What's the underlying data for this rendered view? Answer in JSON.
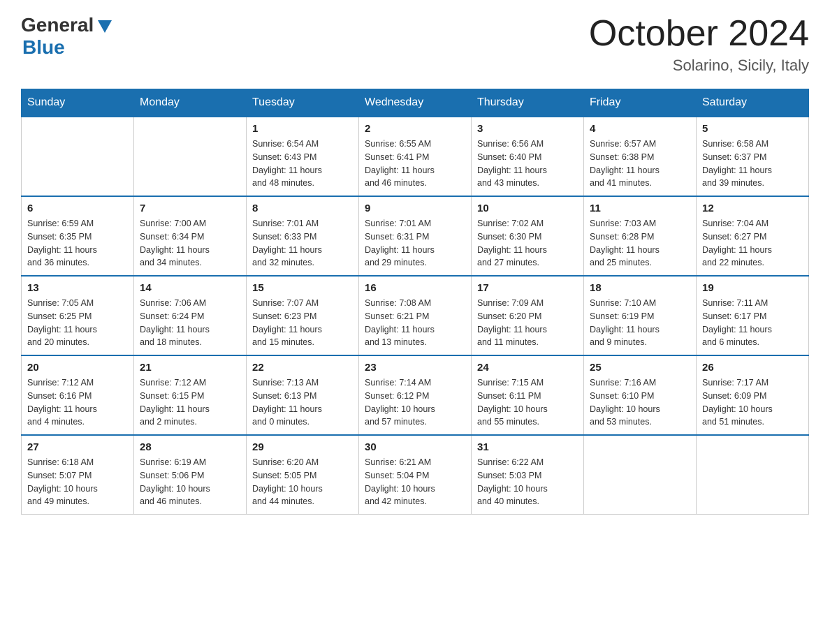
{
  "header": {
    "logo": {
      "general": "General",
      "blue": "Blue"
    },
    "title": "October 2024",
    "location": "Solarino, Sicily, Italy"
  },
  "weekdays": [
    "Sunday",
    "Monday",
    "Tuesday",
    "Wednesday",
    "Thursday",
    "Friday",
    "Saturday"
  ],
  "weeks": [
    [
      {
        "day": "",
        "info": ""
      },
      {
        "day": "",
        "info": ""
      },
      {
        "day": "1",
        "info": "Sunrise: 6:54 AM\nSunset: 6:43 PM\nDaylight: 11 hours\nand 48 minutes."
      },
      {
        "day": "2",
        "info": "Sunrise: 6:55 AM\nSunset: 6:41 PM\nDaylight: 11 hours\nand 46 minutes."
      },
      {
        "day": "3",
        "info": "Sunrise: 6:56 AM\nSunset: 6:40 PM\nDaylight: 11 hours\nand 43 minutes."
      },
      {
        "day": "4",
        "info": "Sunrise: 6:57 AM\nSunset: 6:38 PM\nDaylight: 11 hours\nand 41 minutes."
      },
      {
        "day": "5",
        "info": "Sunrise: 6:58 AM\nSunset: 6:37 PM\nDaylight: 11 hours\nand 39 minutes."
      }
    ],
    [
      {
        "day": "6",
        "info": "Sunrise: 6:59 AM\nSunset: 6:35 PM\nDaylight: 11 hours\nand 36 minutes."
      },
      {
        "day": "7",
        "info": "Sunrise: 7:00 AM\nSunset: 6:34 PM\nDaylight: 11 hours\nand 34 minutes."
      },
      {
        "day": "8",
        "info": "Sunrise: 7:01 AM\nSunset: 6:33 PM\nDaylight: 11 hours\nand 32 minutes."
      },
      {
        "day": "9",
        "info": "Sunrise: 7:01 AM\nSunset: 6:31 PM\nDaylight: 11 hours\nand 29 minutes."
      },
      {
        "day": "10",
        "info": "Sunrise: 7:02 AM\nSunset: 6:30 PM\nDaylight: 11 hours\nand 27 minutes."
      },
      {
        "day": "11",
        "info": "Sunrise: 7:03 AM\nSunset: 6:28 PM\nDaylight: 11 hours\nand 25 minutes."
      },
      {
        "day": "12",
        "info": "Sunrise: 7:04 AM\nSunset: 6:27 PM\nDaylight: 11 hours\nand 22 minutes."
      }
    ],
    [
      {
        "day": "13",
        "info": "Sunrise: 7:05 AM\nSunset: 6:25 PM\nDaylight: 11 hours\nand 20 minutes."
      },
      {
        "day": "14",
        "info": "Sunrise: 7:06 AM\nSunset: 6:24 PM\nDaylight: 11 hours\nand 18 minutes."
      },
      {
        "day": "15",
        "info": "Sunrise: 7:07 AM\nSunset: 6:23 PM\nDaylight: 11 hours\nand 15 minutes."
      },
      {
        "day": "16",
        "info": "Sunrise: 7:08 AM\nSunset: 6:21 PM\nDaylight: 11 hours\nand 13 minutes."
      },
      {
        "day": "17",
        "info": "Sunrise: 7:09 AM\nSunset: 6:20 PM\nDaylight: 11 hours\nand 11 minutes."
      },
      {
        "day": "18",
        "info": "Sunrise: 7:10 AM\nSunset: 6:19 PM\nDaylight: 11 hours\nand 9 minutes."
      },
      {
        "day": "19",
        "info": "Sunrise: 7:11 AM\nSunset: 6:17 PM\nDaylight: 11 hours\nand 6 minutes."
      }
    ],
    [
      {
        "day": "20",
        "info": "Sunrise: 7:12 AM\nSunset: 6:16 PM\nDaylight: 11 hours\nand 4 minutes."
      },
      {
        "day": "21",
        "info": "Sunrise: 7:12 AM\nSunset: 6:15 PM\nDaylight: 11 hours\nand 2 minutes."
      },
      {
        "day": "22",
        "info": "Sunrise: 7:13 AM\nSunset: 6:13 PM\nDaylight: 11 hours\nand 0 minutes."
      },
      {
        "day": "23",
        "info": "Sunrise: 7:14 AM\nSunset: 6:12 PM\nDaylight: 10 hours\nand 57 minutes."
      },
      {
        "day": "24",
        "info": "Sunrise: 7:15 AM\nSunset: 6:11 PM\nDaylight: 10 hours\nand 55 minutes."
      },
      {
        "day": "25",
        "info": "Sunrise: 7:16 AM\nSunset: 6:10 PM\nDaylight: 10 hours\nand 53 minutes."
      },
      {
        "day": "26",
        "info": "Sunrise: 7:17 AM\nSunset: 6:09 PM\nDaylight: 10 hours\nand 51 minutes."
      }
    ],
    [
      {
        "day": "27",
        "info": "Sunrise: 6:18 AM\nSunset: 5:07 PM\nDaylight: 10 hours\nand 49 minutes."
      },
      {
        "day": "28",
        "info": "Sunrise: 6:19 AM\nSunset: 5:06 PM\nDaylight: 10 hours\nand 46 minutes."
      },
      {
        "day": "29",
        "info": "Sunrise: 6:20 AM\nSunset: 5:05 PM\nDaylight: 10 hours\nand 44 minutes."
      },
      {
        "day": "30",
        "info": "Sunrise: 6:21 AM\nSunset: 5:04 PM\nDaylight: 10 hours\nand 42 minutes."
      },
      {
        "day": "31",
        "info": "Sunrise: 6:22 AM\nSunset: 5:03 PM\nDaylight: 10 hours\nand 40 minutes."
      },
      {
        "day": "",
        "info": ""
      },
      {
        "day": "",
        "info": ""
      }
    ]
  ]
}
